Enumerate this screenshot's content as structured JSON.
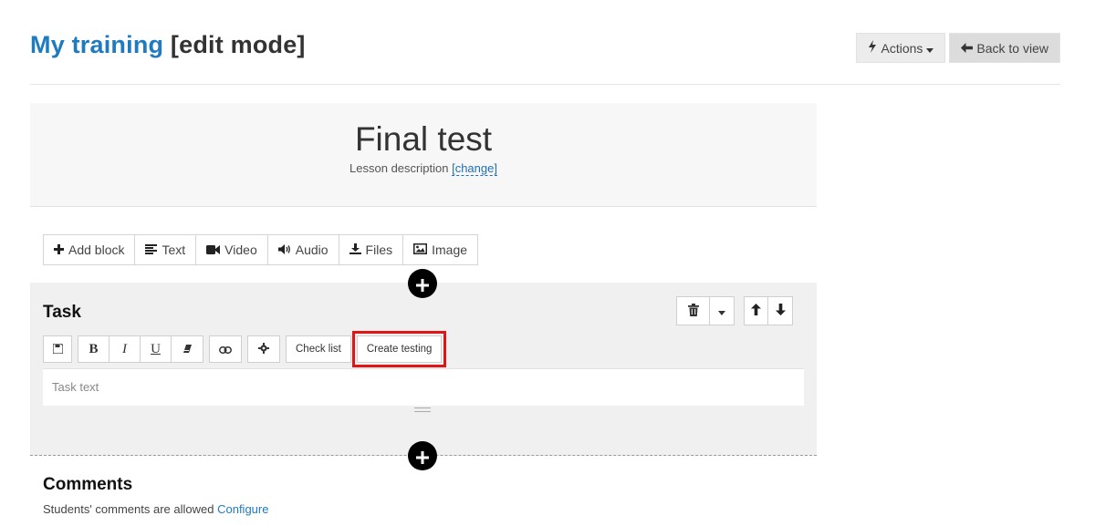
{
  "header": {
    "title_link": "My training",
    "title_mode": "[edit mode]",
    "actions_label": "Actions",
    "back_label": "Back to view"
  },
  "lesson": {
    "title": "Final test",
    "description_label": "Lesson description",
    "change_open": "[",
    "change_label": "change",
    "change_close": "]"
  },
  "block_toolbar": {
    "items": [
      {
        "icon": "plus-icon",
        "label": "Add block"
      },
      {
        "icon": "text-lines-icon",
        "label": "Text"
      },
      {
        "icon": "video-camera-icon",
        "label": "Video"
      },
      {
        "icon": "volume-icon",
        "label": "Audio"
      },
      {
        "icon": "download-icon",
        "label": "Files"
      },
      {
        "icon": "picture-icon",
        "label": "Image"
      }
    ]
  },
  "task": {
    "title": "Task",
    "placeholder": "Task text",
    "editor": {
      "check_list_label": "Check list",
      "create_testing_label": "Create testing"
    }
  },
  "comments": {
    "title": "Comments",
    "text": "Students' comments are allowed",
    "configure_label": "Configure"
  },
  "colors": {
    "link": "#1e7bbf",
    "highlight": "#e01515",
    "block_bg": "#f0f0f0"
  }
}
